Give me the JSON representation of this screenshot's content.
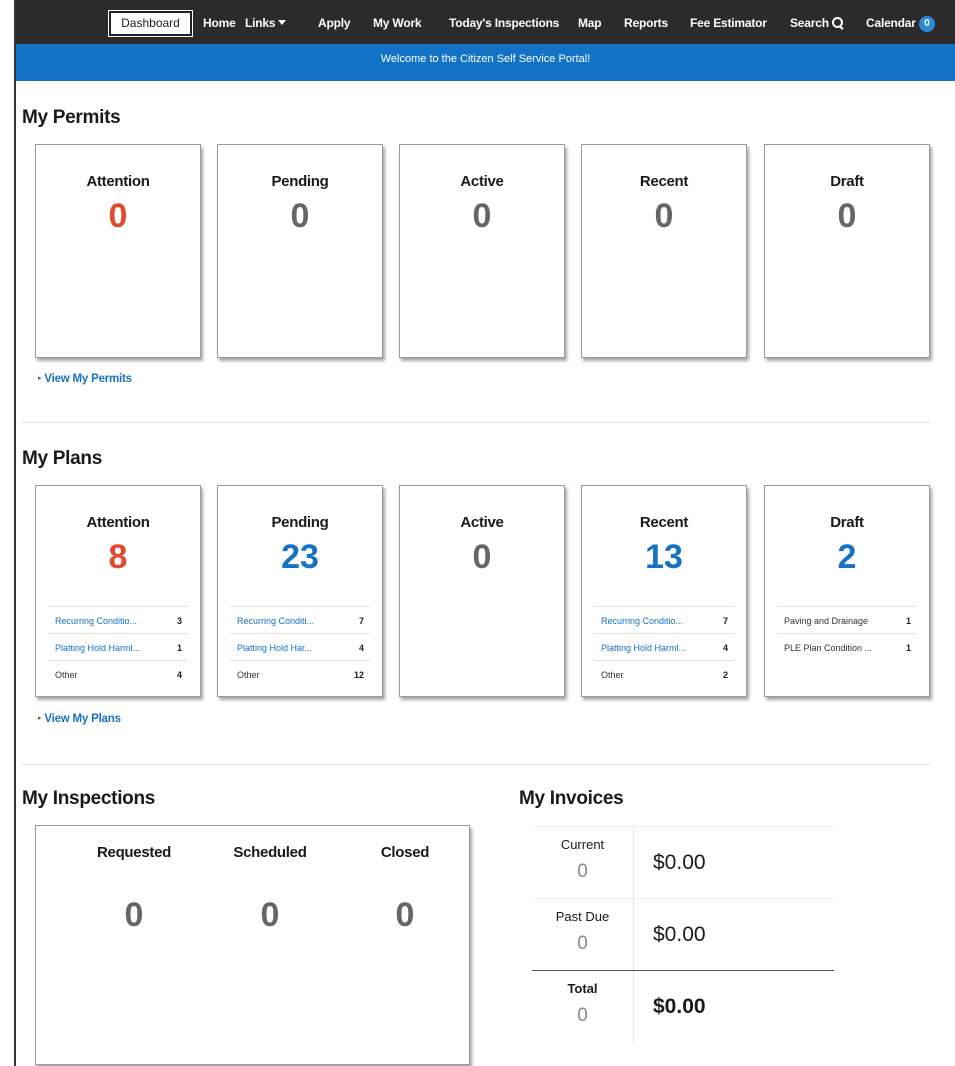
{
  "nav": {
    "dashboard": "Dashboard",
    "home": "Home",
    "links": "Links",
    "apply": "Apply",
    "my_work": "My Work",
    "todays_inspections": "Today's Inspections",
    "map": "Map",
    "reports": "Reports",
    "fee_estimator": "Fee Estimator",
    "search": "Search",
    "calendar": "Calendar",
    "calendar_count": "0"
  },
  "banner": "Welcome to the Citizen Self Service Portal!",
  "permits": {
    "title": "My Permits",
    "view_link": "View My Permits",
    "cards": [
      {
        "label": "Attention",
        "count": "0"
      },
      {
        "label": "Pending",
        "count": "0"
      },
      {
        "label": "Active",
        "count": "0"
      },
      {
        "label": "Recent",
        "count": "0"
      },
      {
        "label": "Draft",
        "count": "0"
      }
    ]
  },
  "plans": {
    "title": "My Plans",
    "view_link": "View My Plans",
    "cards": [
      {
        "label": "Attention",
        "count": "8",
        "rows": [
          {
            "label": "Recurring Conditio...",
            "count": "3"
          },
          {
            "label": "Platting Hold Harml...",
            "count": "1"
          },
          {
            "label": "Other",
            "count": "4"
          }
        ]
      },
      {
        "label": "Pending",
        "count": "23",
        "rows": [
          {
            "label": "Recurring Conditi...",
            "count": "7"
          },
          {
            "label": "Platting Hold Har...",
            "count": "4"
          },
          {
            "label": "Other",
            "count": "12"
          }
        ]
      },
      {
        "label": "Active",
        "count": "0",
        "rows": []
      },
      {
        "label": "Recent",
        "count": "13",
        "rows": [
          {
            "label": "Recurring Conditio...",
            "count": "7"
          },
          {
            "label": "Platting Hold Harml...",
            "count": "4"
          },
          {
            "label": "Other",
            "count": "2"
          }
        ]
      },
      {
        "label": "Draft",
        "count": "2",
        "rows": [
          {
            "label": "Paving and Drainage",
            "count": "1"
          },
          {
            "label": "PLE Plan Condition ...",
            "count": "1"
          }
        ]
      }
    ]
  },
  "inspections": {
    "title": "My Inspections",
    "columns": [
      {
        "label": "Requested",
        "count": "0"
      },
      {
        "label": "Scheduled",
        "count": "0"
      },
      {
        "label": "Closed",
        "count": "0"
      }
    ]
  },
  "invoices": {
    "title": "My Invoices",
    "rows": [
      {
        "label": "Current",
        "count": "0",
        "amount": "$0.00"
      },
      {
        "label": "Past Due",
        "count": "0",
        "amount": "$0.00"
      },
      {
        "label": "Total",
        "count": "0",
        "amount": "$0.00"
      }
    ]
  },
  "icons": {
    "links_dropdown": "chevron-down-icon",
    "search": "search-icon",
    "view_link_bullet": "triangle-right-icon"
  },
  "colors": {
    "nav_bg": "#2b2b2b",
    "banner_bg": "#1272c6",
    "attention": "#e24a2c",
    "link": "#1672c2",
    "muted_count": "#666666"
  }
}
